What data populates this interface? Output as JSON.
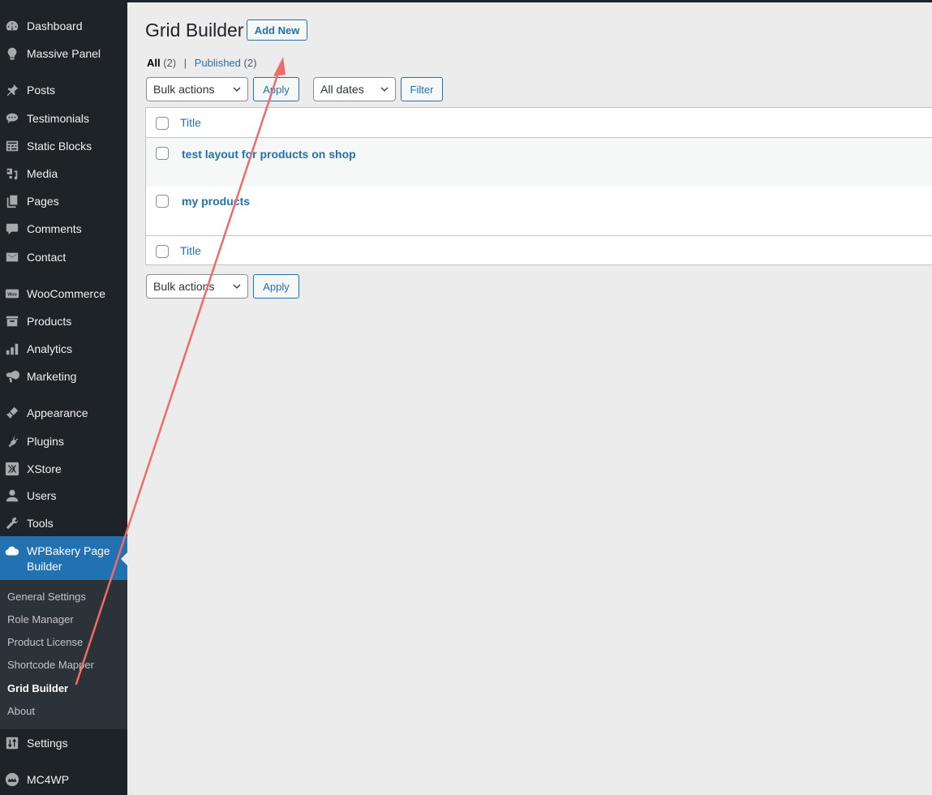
{
  "sidebar": {
    "items": [
      {
        "label": "Dashboard",
        "icon": "dashboard-icon"
      },
      {
        "label": "Massive Panel",
        "icon": "lightbulb-icon"
      },
      {
        "label": "Posts",
        "icon": "pin-icon"
      },
      {
        "label": "Testimonials",
        "icon": "speech-bubble-icon"
      },
      {
        "label": "Static Blocks",
        "icon": "layout-grid-icon"
      },
      {
        "label": "Media",
        "icon": "media-icon"
      },
      {
        "label": "Pages",
        "icon": "pages-icon"
      },
      {
        "label": "Comments",
        "icon": "comment-icon"
      },
      {
        "label": "Contact",
        "icon": "envelope-icon"
      },
      {
        "label": "WooCommerce",
        "icon": "woo-icon"
      },
      {
        "label": "Products",
        "icon": "archive-box-icon"
      },
      {
        "label": "Analytics",
        "icon": "bar-chart-icon"
      },
      {
        "label": "Marketing",
        "icon": "megaphone-icon"
      },
      {
        "label": "Appearance",
        "icon": "paintbrush-icon"
      },
      {
        "label": "Plugins",
        "icon": "plug-icon"
      },
      {
        "label": "XStore",
        "icon": "xstore-icon"
      },
      {
        "label": "Users",
        "icon": "user-icon"
      },
      {
        "label": "Tools",
        "icon": "wrench-icon"
      },
      {
        "label": "WPBakery Page Builder",
        "icon": "cloud-icon"
      },
      {
        "label": "Settings",
        "icon": "sliders-icon"
      },
      {
        "label": "MC4WP",
        "icon": "mc4wp-icon"
      }
    ],
    "submenu": [
      {
        "label": "General Settings"
      },
      {
        "label": "Role Manager"
      },
      {
        "label": "Product License"
      },
      {
        "label": "Shortcode Mapper"
      },
      {
        "label": "Grid Builder",
        "current": true
      },
      {
        "label": "About"
      }
    ]
  },
  "page": {
    "title": "Grid Builder",
    "add_new_label": "Add New"
  },
  "filters": {
    "all_label": "All",
    "all_count": "(2)",
    "separator": "|",
    "published_label": "Published",
    "published_count": "(2)"
  },
  "toolbar_top": {
    "bulk_actions": "Bulk actions",
    "apply_label": "Apply",
    "dates": "All dates",
    "filter_label": "Filter"
  },
  "table": {
    "column_title": "Title",
    "rows": [
      {
        "title": "test layout for products on shop"
      },
      {
        "title": "my products"
      }
    ]
  },
  "toolbar_bottom": {
    "bulk_actions": "Bulk actions",
    "apply_label": "Apply"
  },
  "annotation": {
    "type": "arrow",
    "color": "#f26b6b",
    "from": "Grid Builder submenu item",
    "to": "Add New button"
  }
}
